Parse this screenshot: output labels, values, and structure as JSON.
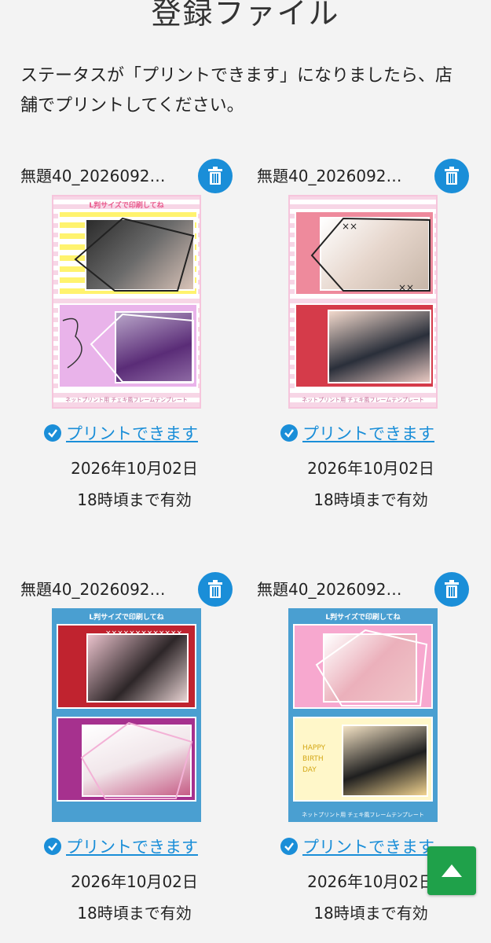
{
  "page": {
    "title": "登録ファイル",
    "intro": "ステータスが「プリントできます」になりましたら、店舗でプリントしてください。"
  },
  "files": [
    {
      "name": "無題40_2026092…",
      "status": "プリントできます",
      "date": "2026年10月02日",
      "expire": "18時頃まで有効",
      "template_header": "L判サイズで印刷してね",
      "template_footer": "ネットプリント用 チェキ風フレームテンプレート",
      "frame_color": "#f7d6e6"
    },
    {
      "name": "無題40_2026092…",
      "status": "プリントできます",
      "date": "2026年10月02日",
      "expire": "18時頃まで有効",
      "template_header": "L判サイズで印刷してね",
      "template_footer": "ネットプリント用 チェキ風フレームテンプレート",
      "frame_color": "#f7d6e6"
    },
    {
      "name": "無題40_2026092…",
      "status": "プリントできます",
      "date": "2026年10月02日",
      "expire": "18時頃まで有効",
      "template_header": "L判サイズで印刷してね",
      "template_footer": "",
      "frame_color": "#4a9fd1"
    },
    {
      "name": "無題40_2026092…",
      "status": "プリントできます",
      "date": "2026年10月02日",
      "expire": "18時頃まで有効",
      "template_header": "L判サイズで印刷してね",
      "template_footer": "ネットプリント用 チェキ風フレームテンプレート",
      "frame_color": "#4a9fd1"
    }
  ],
  "icons": {
    "delete": "trash-icon",
    "status": "check-circle-icon",
    "scroll_top": "arrow-up-icon"
  },
  "colors": {
    "accent": "#1a8ed8",
    "scroll_top_bg": "#1fa14a",
    "background": "#f3f3f3"
  }
}
